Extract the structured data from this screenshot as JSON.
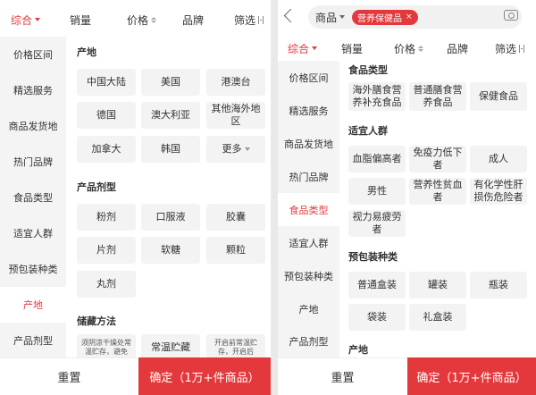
{
  "left": {
    "sortbar": {
      "items": [
        {
          "label": "综合",
          "active": true
        },
        {
          "label": "销量"
        },
        {
          "label": "价格"
        },
        {
          "label": "品牌"
        },
        {
          "label": "筛选"
        }
      ]
    },
    "nav": [
      "价格区间",
      "精选服务",
      "商品发货地",
      "热门品牌",
      "食品类型",
      "适宜人群",
      "预包装种类",
      "产地",
      "产品剂型"
    ],
    "active_nav": "产地",
    "sections": {
      "origin": {
        "title": "产地",
        "options": [
          "中国大陆",
          "美国",
          "港澳台",
          "德国",
          "澳大利亚",
          "其他海外地区",
          "加拿大",
          "韩国",
          "更多"
        ]
      },
      "dosage": {
        "title": "产品剂型",
        "options": [
          "粉剂",
          "口服液",
          "胶囊",
          "片剂",
          "软糖",
          "颗粒",
          "丸剂"
        ]
      },
      "storage": {
        "title": "储藏方法",
        "options": [
          "须阴凉干燥处常温贮存，避免",
          "常温贮藏",
          "开启前常温贮存，开启后"
        ]
      }
    },
    "footer": {
      "reset": "重置",
      "confirm": "确定（1万+件商品）"
    }
  },
  "right": {
    "search": {
      "scope": "商品",
      "tag": "营养保健品",
      "tag_close": "×"
    },
    "sortbar": {
      "items": [
        {
          "label": "综合",
          "active": true
        },
        {
          "label": "销量"
        },
        {
          "label": "价格"
        },
        {
          "label": "品牌"
        },
        {
          "label": "筛选"
        }
      ]
    },
    "nav": [
      "价格区间",
      "精选服务",
      "商品发货地",
      "热门品牌",
      "食品类型",
      "适宜人群",
      "预包装种类",
      "产地",
      "产品剂型"
    ],
    "active_nav": "食品类型",
    "sections": {
      "food_type": {
        "title": "食品类型",
        "options": [
          "海外膳食营养补充食品",
          "普通膳食营养食品",
          "保健食品"
        ]
      },
      "crowd": {
        "title": "适宜人群",
        "options": [
          "血脂偏高者",
          "免疫力低下者",
          "成人",
          "男性",
          "营养性贫血者",
          "有化学性肝损伤危险者",
          "视力易疲劳者"
        ]
      },
      "package": {
        "title": "预包装种类",
        "options": [
          "普通盒装",
          "罐装",
          "瓶装",
          "袋装",
          "礼盒装"
        ]
      },
      "origin": {
        "title": "产地"
      }
    },
    "footer": {
      "reset": "重置",
      "confirm": "确定（1万+件商品）"
    }
  },
  "colors": {
    "accent": "#e4393c",
    "chip_bg": "#f3f3f3",
    "nav_bg": "#f4f4f4"
  }
}
